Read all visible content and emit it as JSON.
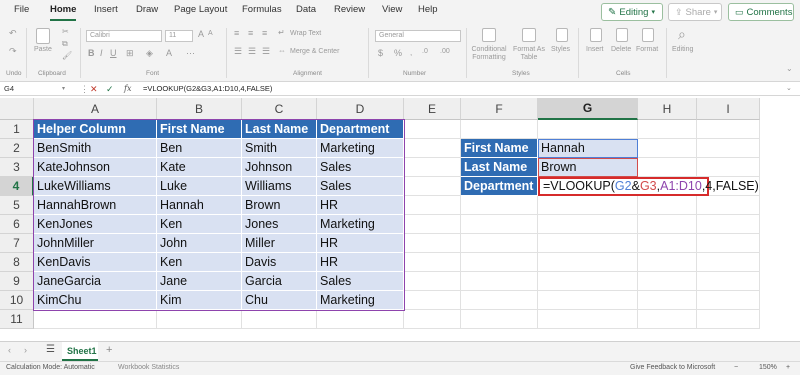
{
  "menu": {
    "tabs": [
      "File",
      "Home",
      "Insert",
      "Draw",
      "Page Layout",
      "Formulas",
      "Data",
      "Review",
      "View",
      "Help"
    ],
    "editing_label": "Editing",
    "share_label": "Share",
    "comments_label": "Comments"
  },
  "ribbon": {
    "undo_group": "Undo",
    "paste_label": "Paste",
    "clipboard_group": "Clipboard",
    "font_name": "Calibri",
    "font_size": "11",
    "font_group": "Font",
    "wrap_text": "Wrap Text",
    "merge_center": "Merge & Center",
    "alignment_group": "Alignment",
    "number_format": "General",
    "number_group": "Number",
    "conditional_formatting": "Conditional Formatting",
    "format_as_table": "Format As Table",
    "styles_label": "Styles",
    "styles_group": "Styles",
    "insert_label": "Insert",
    "delete_label": "Delete",
    "format_label": "Format",
    "cells_group": "Cells",
    "editing_label": "Editing"
  },
  "formula_bar": {
    "name_box": "G4",
    "fx": "fx",
    "formula": "=VLOOKUP(G2&G3,A1:D10,4,FALSE)"
  },
  "columns": [
    "A",
    "B",
    "C",
    "D",
    "E",
    "F",
    "G",
    "H",
    "I"
  ],
  "selected_column": "G",
  "rows": [
    "1",
    "2",
    "3",
    "4",
    "5",
    "6",
    "7",
    "8",
    "9",
    "10",
    "11"
  ],
  "selected_row": "4",
  "table": {
    "headers": [
      "Helper Column",
      "First Name",
      "Last Name",
      "Department"
    ],
    "data": [
      [
        "BenSmith",
        "Ben",
        "Smith",
        "Marketing"
      ],
      [
        "KateJohnson",
        "Kate",
        "Johnson",
        "Sales"
      ],
      [
        "LukeWilliams",
        "Luke",
        "Williams",
        "Sales"
      ],
      [
        "HannahBrown",
        "Hannah",
        "Brown",
        "HR"
      ],
      [
        "KenJones",
        "Ken",
        "Jones",
        "Marketing"
      ],
      [
        "JohnMiller",
        "John",
        "Miller",
        "HR"
      ],
      [
        "KenDavis",
        "Ken",
        "Davis",
        "HR"
      ],
      [
        "JaneGarcia",
        "Jane",
        "Garcia",
        "Sales"
      ],
      [
        "KimChu",
        "Kim",
        "Chu",
        "Marketing"
      ]
    ]
  },
  "lookup": {
    "labels": [
      "First Name",
      "Last Name",
      "Department"
    ],
    "first_name": "Hannah",
    "last_name": "Brown",
    "formula_parts": [
      "=VLOOKUP(",
      "G2",
      "&",
      "G3",
      ",",
      "A1:D10",
      ",4,FALSE)"
    ]
  },
  "sheet_tabs": {
    "active": "Sheet1"
  },
  "status": {
    "calc_mode": "Calculation Mode: Automatic",
    "workbook_stats": "Workbook Statistics",
    "feedback": "Give Feedback to Microsoft",
    "zoom": "150%"
  },
  "colors": {
    "header_blue": "#2f6cb3",
    "row_fill": "#d9e1f2",
    "ref_g2": "#4f7fd6",
    "ref_g3": "#d24b4b",
    "ref_range": "#8e44ad",
    "active_cell_border": "#d62b2b",
    "excel_green": "#217346"
  }
}
